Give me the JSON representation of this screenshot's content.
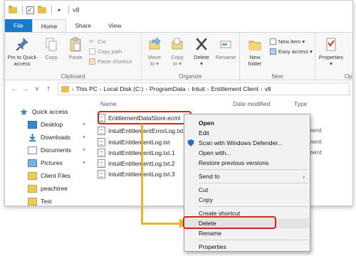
{
  "titlebar": {
    "path_title": "v8",
    "qat_check": "✓",
    "qat_dropdown": "▾"
  },
  "tabs": [
    "File",
    "Home",
    "Share",
    "View"
  ],
  "ribbon": {
    "clipboard": {
      "label": "Clipboard",
      "pin_line1": "Pin to Quick",
      "pin_line2": "access",
      "copy": "Copy",
      "paste": "Paste",
      "cut": "Cut",
      "copy_path": "Copy path",
      "paste_shortcut": "Paste shortcut"
    },
    "organize": {
      "label": "Organize",
      "move_to_1": "Move",
      "move_to_2": "to ▾",
      "copy_to_1": "Copy",
      "copy_to_2": "to ▾",
      "delete_1": "Delete",
      "delete_2": "▾",
      "rename_1": "Rename"
    },
    "new": {
      "label": "New",
      "new_folder_1": "New",
      "new_folder_2": "folder",
      "new_item": "New item ▾",
      "easy_access": "Easy access ▾"
    },
    "open": {
      "label": "Ope",
      "properties_1": "Properties",
      "properties_2": "▾"
    }
  },
  "address": {
    "back": "←",
    "forward": "→",
    "recent": "˅",
    "up": "↑",
    "crumbs": [
      "This PC",
      "Local Disk (C:)",
      "ProgramData",
      "Intuit",
      "Entitlement Client",
      "v8"
    ],
    "sep": "›"
  },
  "navpane": {
    "items": [
      {
        "label": "Quick access",
        "icon": "star-icon"
      },
      {
        "label": "Desktop",
        "icon": "desktop-icon"
      },
      {
        "label": "Downloads",
        "icon": "download-icon"
      },
      {
        "label": "Documents",
        "icon": "documents-icon"
      },
      {
        "label": "Pictures",
        "icon": "pictures-icon"
      },
      {
        "label": "Client Files",
        "icon": "folder-icon"
      },
      {
        "label": "peachtree",
        "icon": "folder-icon"
      },
      {
        "label": "Test",
        "icon": "folder-icon"
      }
    ],
    "pin": "📌"
  },
  "filelist": {
    "col_name": "Name",
    "col_date": "Date modified",
    "col_type": "Type",
    "files": [
      {
        "name": "EntitlementDataStore.ecml",
        "type": "File"
      },
      {
        "name": "IntuitEntitlementErrorLog.txt",
        "type": "ocument"
      },
      {
        "name": "IntuitEntitlementLog.txt",
        "type": "ocument"
      },
      {
        "name": "IntuitEntitlementLog.txt.1",
        "type": "ocument"
      },
      {
        "name": "IntuitEntitlementLog.txt.2",
        "type": ""
      },
      {
        "name": "IntuitEntitlementLog.txt.3",
        "type": ""
      }
    ]
  },
  "context_menu": {
    "open": "Open",
    "edit": "Edit",
    "scan": "Scan with Windows Defender...",
    "open_with": "Open with...",
    "restore": "Restore previous versions",
    "send_to": "Send to",
    "send_to_arrow": "›",
    "cut": "Cut",
    "copy": "Copy",
    "create_shortcut": "Create shortcut",
    "delete": "Delete",
    "rename": "Rename",
    "properties": "Properties"
  },
  "colors": {
    "file_tab": "#1979ca",
    "highlight": "#d42020",
    "connector": "#e8b52a"
  }
}
